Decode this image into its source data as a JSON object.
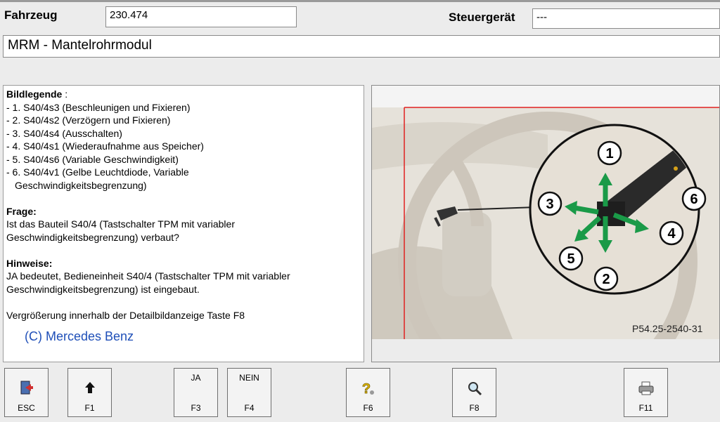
{
  "header": {
    "vehicle_label": "Fahrzeug",
    "vehicle_value": "230.474",
    "control_unit_label": "Steuergerät",
    "control_unit_value": "---"
  },
  "module_title": "MRM - Mantelrohrmodul",
  "legend": {
    "title": "Bildlegende",
    "title_suffix": " :",
    "items": [
      "- 1. S40/4s3 (Beschleunigen und Fixieren)",
      "- 2. S40/4s2 (Verzögern und Fixieren)",
      "- 3. S40/4s4 (Ausschalten)",
      "- 4. S40/4s1 (Wiederaufnahme aus Speicher)",
      "- 5. S40/4s6 (Variable Geschwindigkeit)",
      "- 6. S40/4v1 (Gelbe Leuchtdiode, Variable",
      "Geschwindigkeitsbegrenzung)"
    ],
    "question_title": "Frage:",
    "question_lines": [
      "Ist das Bauteil S40/4 (Tastschalter TPM mit variabler",
      "Geschwindigkeitsbegrenzung) verbaut?"
    ],
    "notes_title": "Hinweise:",
    "notes_lines": [
      "JA bedeutet, Bedieneinheit S40/4 (Tastschalter TPM mit variabler",
      "Geschwindigkeitsbegrenzung) ist eingebaut."
    ],
    "zoom_hint": "Vergrößerung innerhalb der Detailbildanzeige Taste F8",
    "copyright": "(C) Mercedes Benz"
  },
  "image": {
    "callouts": [
      "1",
      "2",
      "3",
      "4",
      "5",
      "6"
    ],
    "reference": "P54.25-2540-31",
    "arrow_color": "#1a9a48",
    "frame_color": "#e02020"
  },
  "buttons": {
    "esc": {
      "bottom": "ESC",
      "icon": "exit-door-icon"
    },
    "f1": {
      "bottom": "F1",
      "icon": "up-arrow-icon"
    },
    "f3": {
      "top": "JA",
      "bottom": "F3"
    },
    "f4": {
      "top": "NEIN",
      "bottom": "F4"
    },
    "f6": {
      "bottom": "F6",
      "icon": "help-question-icon"
    },
    "f8": {
      "bottom": "F8",
      "icon": "magnifier-icon"
    },
    "f11": {
      "bottom": "F11",
      "icon": "printer-icon"
    }
  }
}
